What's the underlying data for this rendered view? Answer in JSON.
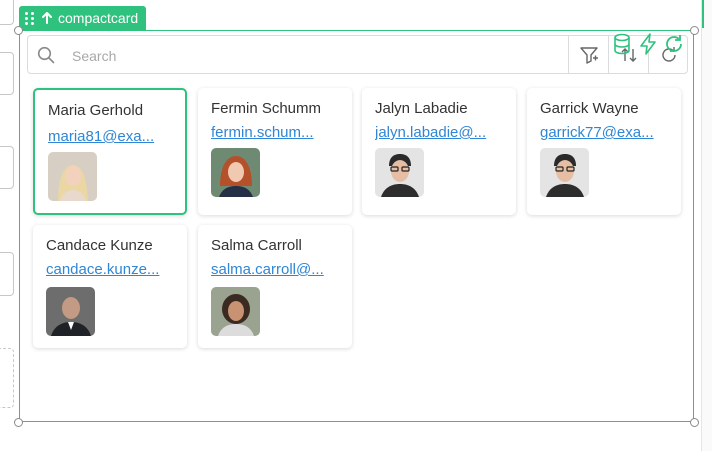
{
  "component": {
    "tag_label": "compactcard"
  },
  "search": {
    "placeholder": "Search",
    "value": ""
  },
  "cards": [
    {
      "name": "Maria Gerhold",
      "email": "maria81@exa...",
      "selected": true
    },
    {
      "name": "Fermin Schumm",
      "email": "fermin.schum..."
    },
    {
      "name": "Jalyn Labadie",
      "email": "jalyn.labadie@..."
    },
    {
      "name": "Garrick Wayne",
      "email": "garrick77@exa..."
    },
    {
      "name": "Candace Kunze",
      "email": "candace.kunze..."
    },
    {
      "name": "Salma Carroll",
      "email": "salma.carroll@..."
    }
  ],
  "icons": {
    "frame_tools": [
      "database-icon",
      "lightning-icon",
      "refresh-icon"
    ],
    "toolbar": [
      "search-icon",
      "filter-icon",
      "sort-icon",
      "refresh-icon"
    ]
  },
  "colors": {
    "accent": "#2ec27e",
    "link": "#2f86d6",
    "text": "#333333"
  }
}
